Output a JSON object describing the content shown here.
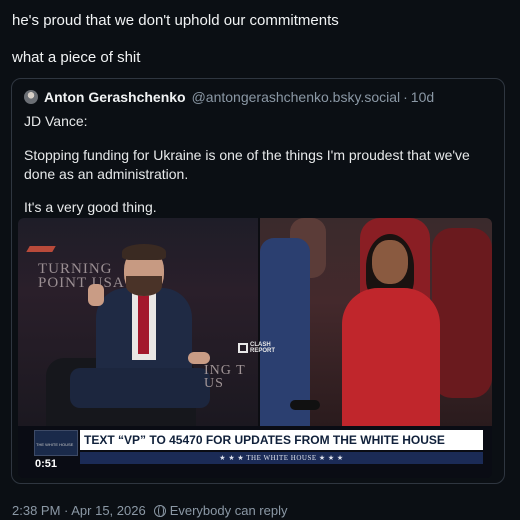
{
  "post": {
    "line1": "he's proud that we don't uphold our commitments",
    "line2": "what a piece of shit",
    "footer": {
      "timestamp": "2:38 PM · Apr 15, 2026",
      "reply_setting": "Everybody can reply",
      "reply_icon": "globe-icon"
    }
  },
  "quote": {
    "author": "Anton Gerashchenko",
    "handle": "@antongerashchenko.bsky.social",
    "separator": "·",
    "age": "10d",
    "text1": "JD Vance:",
    "text2": "Stopping funding for Ukraine is one of the things I'm proudest that we've done as an administration.",
    "text3": "It's a very good thing."
  },
  "video": {
    "duration": "0:51",
    "backdrop_left": "TURNING POINT USA",
    "backdrop_right": "ING T US",
    "watermark": "CLASH REPORT",
    "banner_main": "TEXT “VP” TO 45470 FOR UPDATES FROM THE WHITE HOUSE",
    "banner_sub": "★ ★ ★  THE WHITE HOUSE  ★ ★ ★",
    "seal_text": "THE WHITE HOUSE"
  },
  "colors": {
    "background": "#0b0f14",
    "muted": "#8b98a5",
    "banner_blue": "#1b2b56"
  }
}
